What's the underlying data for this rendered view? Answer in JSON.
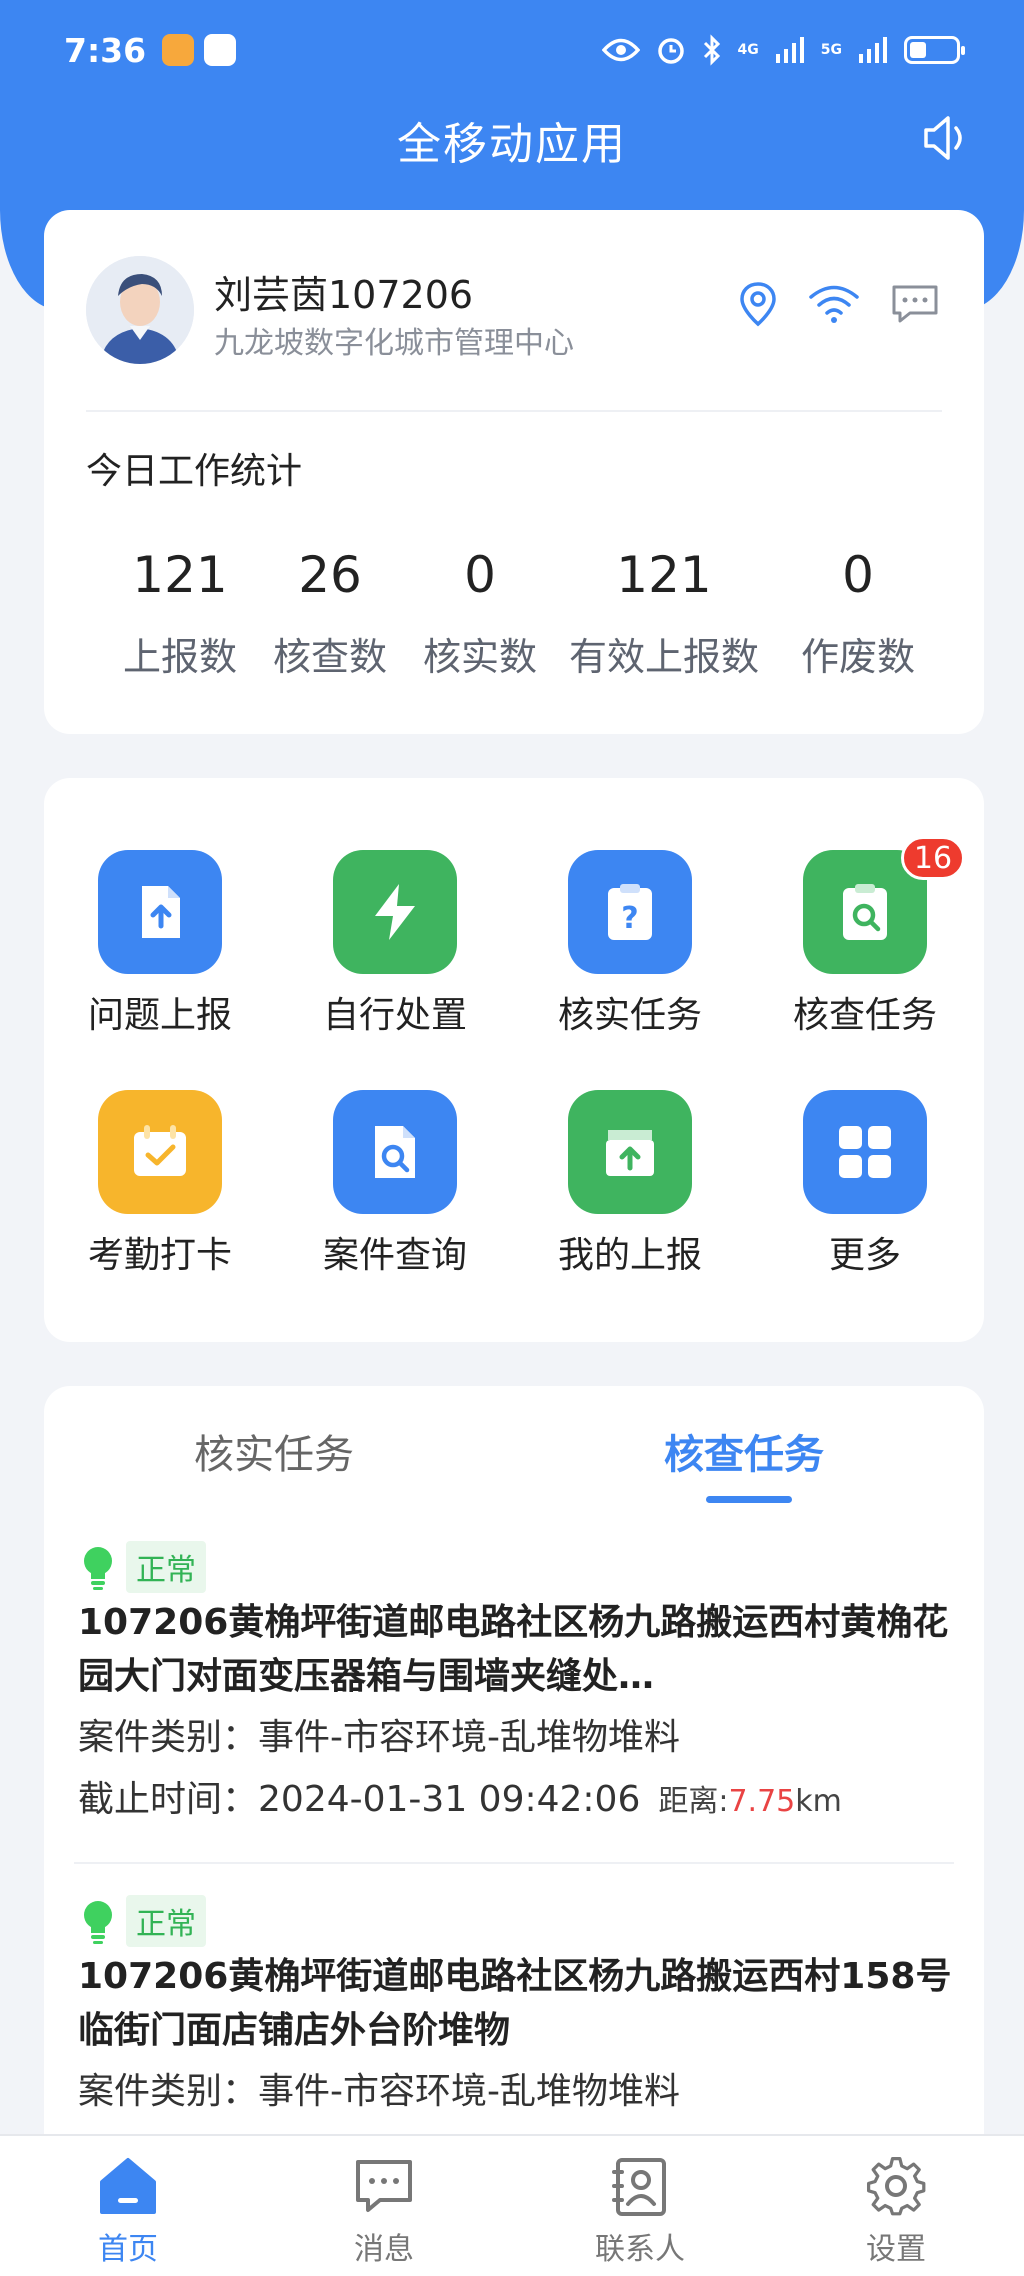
{
  "status_bar": {
    "time": "7:36",
    "network_1": "4G",
    "network_2": "5G"
  },
  "header": {
    "title": "全移动应用"
  },
  "profile": {
    "name": "刘芸茵107206",
    "org": "九龙坡数字化城市管理中心"
  },
  "stats": {
    "title": "今日工作统计",
    "items": [
      {
        "value": "121",
        "label": "上报数"
      },
      {
        "value": "26",
        "label": "核查数"
      },
      {
        "value": "0",
        "label": "核实数"
      },
      {
        "value": "121",
        "label": "有效上报数"
      },
      {
        "value": "0",
        "label": "作废数"
      }
    ]
  },
  "grid": {
    "items": [
      {
        "label": "问题上报",
        "icon": "upload-doc-icon",
        "color": "#3d86f2"
      },
      {
        "label": "自行处置",
        "icon": "lightning-icon",
        "color": "#3fb45f"
      },
      {
        "label": "核实任务",
        "icon": "question-clipboard-icon",
        "color": "#3d86f2"
      },
      {
        "label": "核查任务",
        "icon": "search-clipboard-icon",
        "color": "#3fb45f",
        "badge": "16"
      },
      {
        "label": "考勤打卡",
        "icon": "calendar-check-icon",
        "color": "#f7b52c"
      },
      {
        "label": "案件查询",
        "icon": "search-doc-icon",
        "color": "#3d86f2"
      },
      {
        "label": "我的上报",
        "icon": "upload-box-icon",
        "color": "#3fb45f"
      },
      {
        "label": "更多",
        "icon": "grid-icon",
        "color": "#3d86f2"
      }
    ]
  },
  "tasks": {
    "tabs": [
      "核实任务",
      "核查任务"
    ],
    "active_tab": "核查任务",
    "items": [
      {
        "status": "正常",
        "title": "107206黄桷坪街道邮电路社区杨九路搬运西村黄桷花园大门对面变压器箱与围墙夹缝处…",
        "category_label": "案件类别：",
        "category": "事件-市容环境-乱堆物堆料",
        "deadline_label": "截止时间：",
        "deadline": "2024-01-31 09:42:06",
        "distance_label": "距离:",
        "distance_value": "7.75",
        "distance_unit": "km"
      },
      {
        "status": "正常",
        "title": "107206黄桷坪街道邮电路社区杨九路搬运西村158号临街门面店铺店外台阶堆物",
        "category_label": "案件类别：",
        "category": "事件-市容环境-乱堆物堆料"
      }
    ]
  },
  "bottom_nav": {
    "items": [
      {
        "label": "首页",
        "icon": "home-icon",
        "active": true
      },
      {
        "label": "消息",
        "icon": "message-icon",
        "active": false
      },
      {
        "label": "联系人",
        "icon": "contacts-icon",
        "active": false
      },
      {
        "label": "设置",
        "icon": "settings-icon",
        "active": false
      }
    ]
  },
  "colors": {
    "primary": "#3d86f2",
    "green": "#3fb45f",
    "orange": "#f7b52c",
    "badge_red": "#ee3b2e",
    "distance_red": "#e94343"
  }
}
